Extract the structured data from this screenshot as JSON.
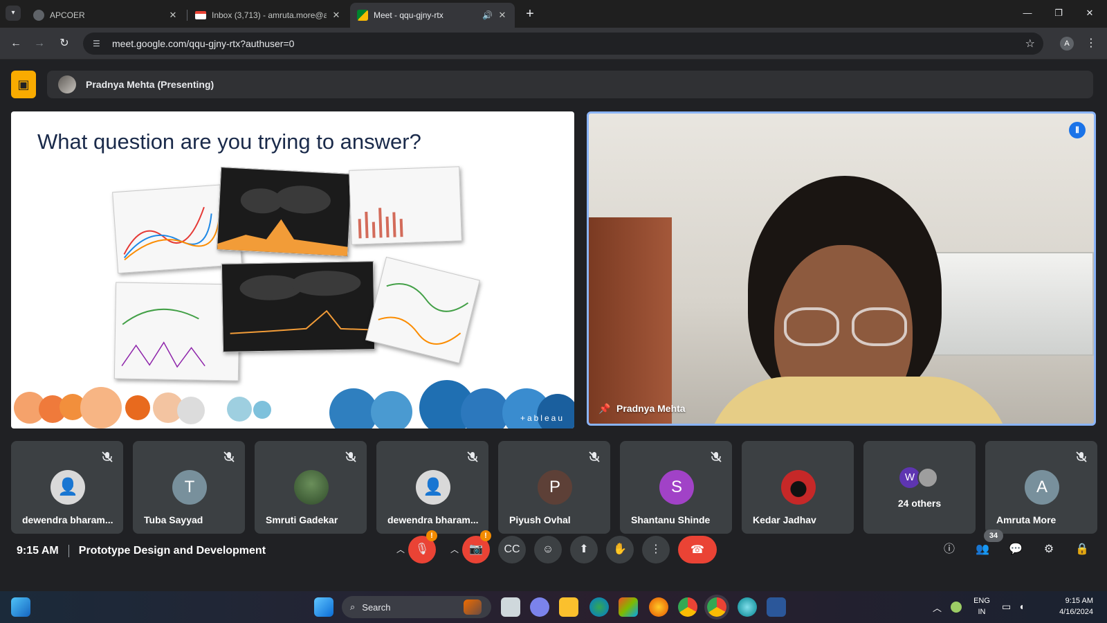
{
  "browser": {
    "tabs": [
      {
        "title": "APCOER",
        "active": false
      },
      {
        "title": "Inbox (3,713) - amruta.more@a",
        "active": false
      },
      {
        "title": "Meet - qqu-gjny-rtx",
        "active": true
      }
    ],
    "new_tab": "+",
    "url": "meet.google.com/qqu-gjny-rtx?authuser=0",
    "profile_initial": "A"
  },
  "meet": {
    "presenter_bar": "Pradnya Mehta (Presenting)",
    "slide": {
      "title": "What question are you trying to answer?",
      "logo": "+ableau"
    },
    "speaker": {
      "name": "Pradnya Mehta"
    },
    "participants": [
      {
        "name": "dewendra bharam...",
        "initial": "",
        "color": "#c9c9c9",
        "muted": true
      },
      {
        "name": "Tuba Sayyad",
        "initial": "T",
        "color": "#78909c",
        "muted": true
      },
      {
        "name": "Smruti Gadekar",
        "initial": "",
        "color": "#6a8f5a",
        "muted": true
      },
      {
        "name": "dewendra bharam...",
        "initial": "",
        "color": "#c9c9c9",
        "muted": true
      },
      {
        "name": "Piyush Ovhal",
        "initial": "P",
        "color": "#5d4037",
        "muted": true
      },
      {
        "name": "Shantanu Shinde",
        "initial": "S",
        "color": "#a142c7",
        "muted": true
      },
      {
        "name": "Kedar Jadhav",
        "initial": "",
        "color": "#c62828",
        "muted": false
      },
      {
        "name": "24 others",
        "initial": "W",
        "color": "#5e35b1",
        "muted": false
      },
      {
        "name": "Amruta More",
        "initial": "A",
        "color": "#78909c",
        "muted": true
      }
    ],
    "time": "9:15 AM",
    "meeting_title": "Prototype Design and Development",
    "people_count": "34",
    "warn_badge": "!"
  },
  "taskbar": {
    "search_label": "Search",
    "lang_top": "ENG",
    "lang_bottom": "IN",
    "time": "9:15 AM",
    "date": "4/16/2024"
  },
  "colors": {
    "accent_blue": "#8ab4f8",
    "end_call_red": "#ea4335",
    "presenting_yellow": "#f9ab00"
  }
}
